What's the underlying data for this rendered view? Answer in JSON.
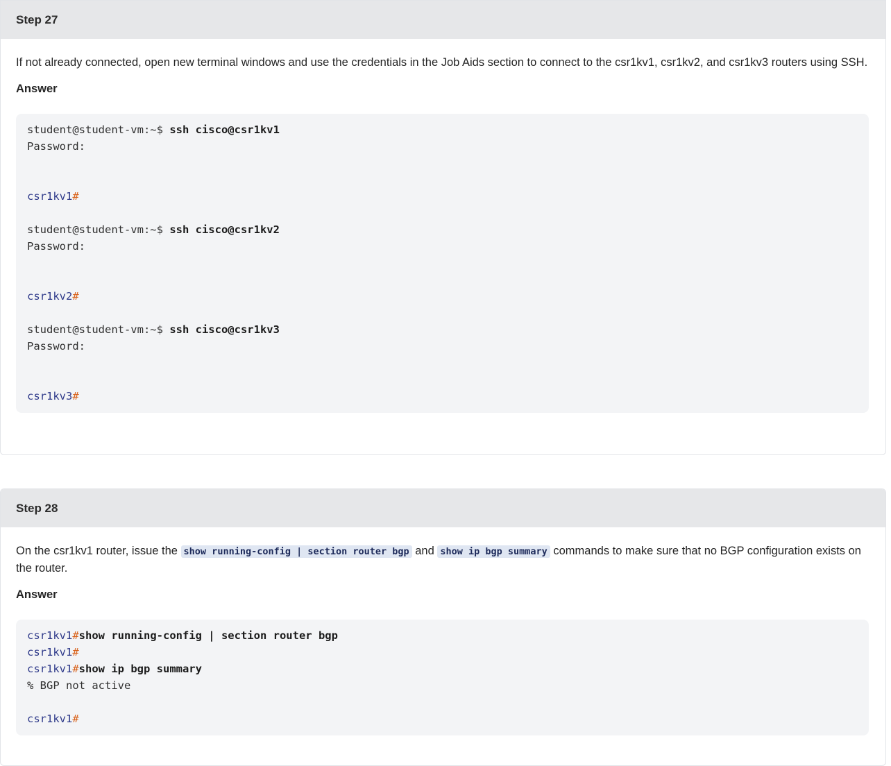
{
  "step27": {
    "header": "Step 27",
    "instruction": "If not already connected, open new terminal windows and use the credentials in the Job Aids section to connect to the csr1kv1, csr1kv2, and csr1kv3 routers using SSH.",
    "answer_label": "Answer",
    "code": {
      "prompt": "student@student-vm:~$ ",
      "cmd1": "ssh cisco@csr1kv1",
      "cmd2": "ssh cisco@csr1kv2",
      "cmd3": "ssh cisco@csr1kv3",
      "password": "Password:",
      "host1": "csr1kv1",
      "host2": "csr1kv2",
      "host3": "csr1kv3",
      "hash": "#"
    }
  },
  "step28": {
    "header": "Step 28",
    "instruction_before": "On the csr1kv1 router, issue the ",
    "inline_cmd1": "show running-config | section router bgp",
    "instruction_mid": " and ",
    "inline_cmd2": "show ip bgp summary",
    "instruction_after": " commands to make sure that no BGP configuration exists on the router.",
    "answer_label": "Answer",
    "code": {
      "host": "csr1kv1",
      "hash": "#",
      "cmd1": "show running-config | section router bgp",
      "cmd2": "show ip bgp summary",
      "output": "% BGP not active"
    }
  },
  "colors": {
    "header_bg": "#e6e7e9",
    "code_bg": "#f3f4f6",
    "host_color": "#2f3a8a",
    "hash_color": "#d9631c",
    "inline_code_bg": "#dfe6f2"
  }
}
